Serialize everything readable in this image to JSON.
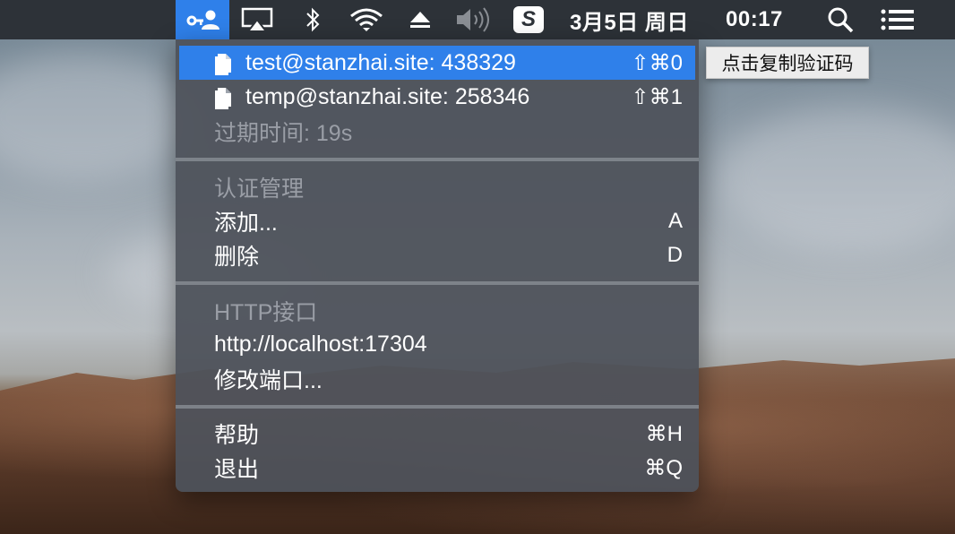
{
  "menubar": {
    "app_icon": "key-person-icon",
    "status_icons": [
      "airplay-icon",
      "bluetooth-icon",
      "wifi-icon",
      "eject-icon",
      "volume-icon",
      "sogou-input-icon"
    ],
    "input_badge": "S",
    "date": "3月5日 周日",
    "time": "00:17",
    "right_icons": [
      "spotlight-search-icon",
      "notification-center-icon"
    ]
  },
  "menu": {
    "codes": [
      {
        "label": "test@stanzhai.site: 438329",
        "shortcut": "⇧⌘0",
        "highlighted": true
      },
      {
        "label": "temp@stanzhai.site: 258346",
        "shortcut": "⇧⌘1",
        "highlighted": false
      }
    ],
    "expiry": "过期时间: 19s",
    "auth_section": {
      "title": "认证管理",
      "items": [
        {
          "label": "添加...",
          "shortcut": "A"
        },
        {
          "label": "删除",
          "shortcut": "D"
        }
      ]
    },
    "http_section": {
      "title": "HTTP接口",
      "url": "http://localhost:17304",
      "modify_port": "修改端口..."
    },
    "footer": [
      {
        "label": "帮助",
        "shortcut": "⌘H"
      },
      {
        "label": "退出",
        "shortcut": "⌘Q"
      }
    ]
  },
  "tooltip": "点击复制验证码",
  "colors": {
    "menubar_bg": "#2d3238",
    "accent": "#2f80ea",
    "menu_bg": "#4e525a",
    "disabled_text": "#9a9ea6"
  }
}
